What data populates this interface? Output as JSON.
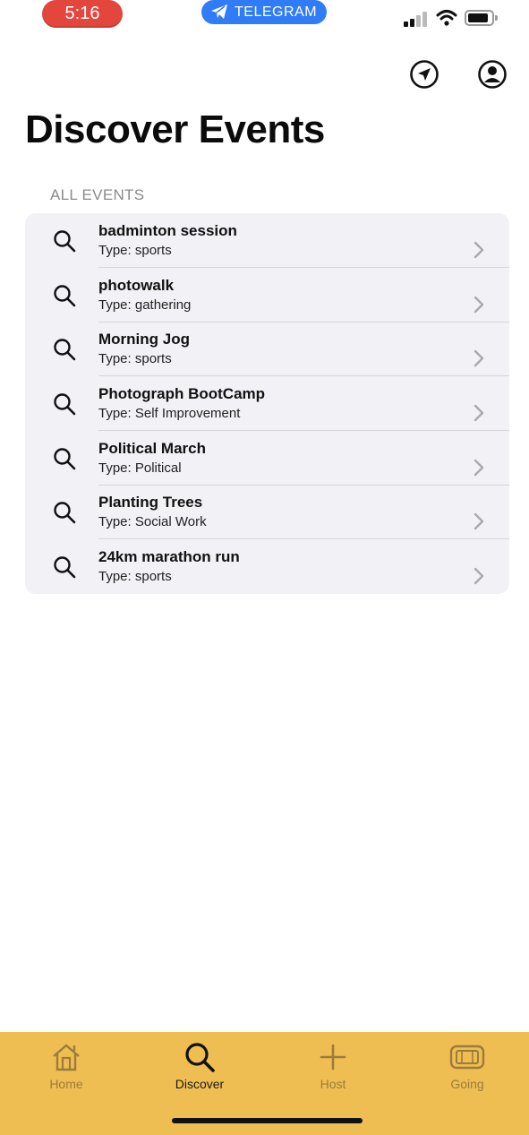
{
  "status_bar": {
    "time": "5:16",
    "app_pill": "TELEGRAM",
    "time_pill_color": "#e2463c",
    "app_pill_color": "#2f7cf6"
  },
  "header": {
    "title": "Discover Events",
    "actions": [
      "location-arrow-icon",
      "profile-icon"
    ]
  },
  "section": {
    "label": "ALL EVENTS"
  },
  "events": [
    {
      "name": "badminton session",
      "type": "Type: sports"
    },
    {
      "name": "photowalk",
      "type": "Type: gathering"
    },
    {
      "name": "Morning Jog",
      "type": "Type: sports"
    },
    {
      "name": "Photograph BootCamp",
      "type": "Type: Self Improvement"
    },
    {
      "name": "Political March",
      "type": "Type: Political"
    },
    {
      "name": "Planting Trees",
      "type": "Type: Social Work"
    },
    {
      "name": "24km marathon run",
      "type": "Type: sports"
    }
  ],
  "tab_bar": {
    "background": "#efbe52",
    "tabs": [
      {
        "label": "Home",
        "icon": "home-icon",
        "active": false
      },
      {
        "label": "Discover",
        "icon": "search-icon",
        "active": true
      },
      {
        "label": "Host",
        "icon": "plus-icon",
        "active": false
      },
      {
        "label": "Going",
        "icon": "ticket-icon",
        "active": false
      }
    ]
  }
}
